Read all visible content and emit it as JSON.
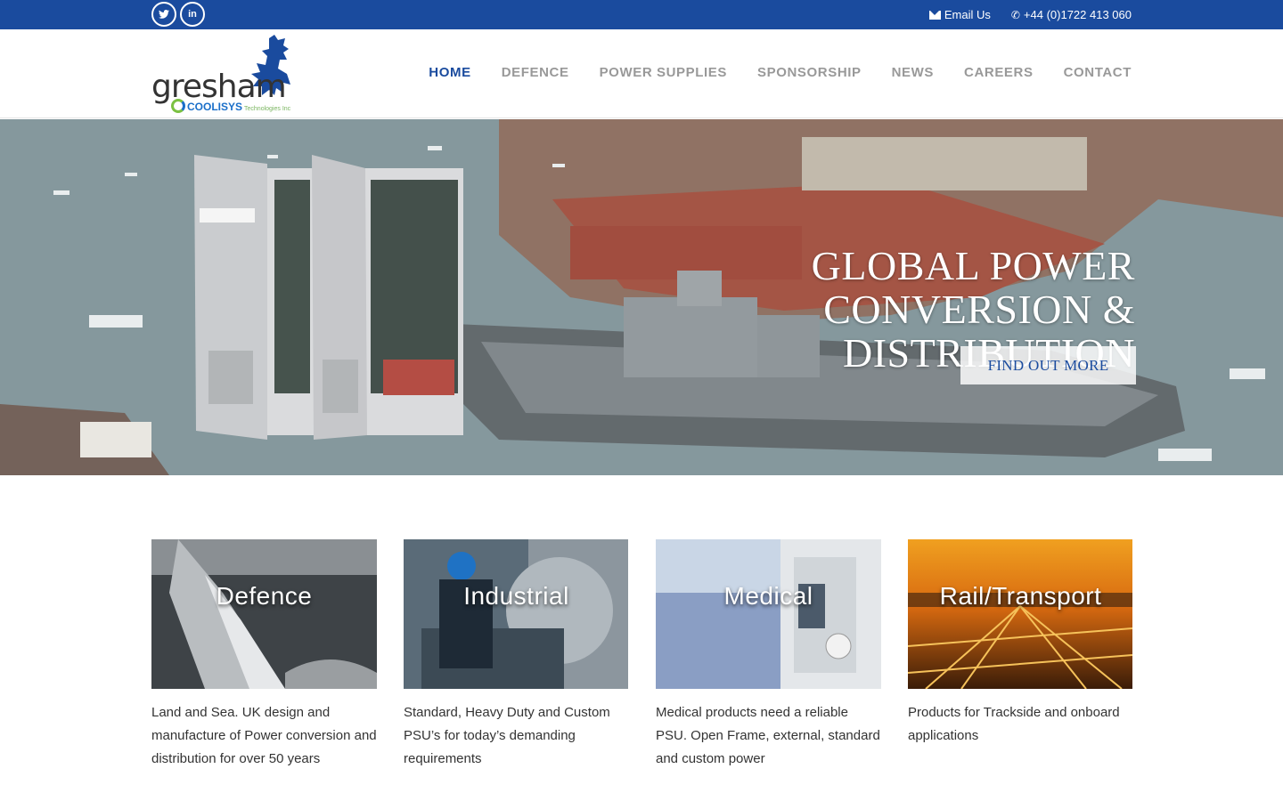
{
  "topbar": {
    "social": [
      {
        "icon": "twitter-icon",
        "glyph": "🐦"
      },
      {
        "icon": "linkedin-icon",
        "glyph": "in"
      }
    ],
    "email_label": "Email Us",
    "phone_label": "+44 (0)1722 413 060"
  },
  "brand": {
    "name": "gresham",
    "sub_brand": "COOLISYS",
    "sub_brand_tag": "Technologies Inc"
  },
  "nav": {
    "items": [
      {
        "label": "HOME",
        "active": true
      },
      {
        "label": "DEFENCE",
        "active": false
      },
      {
        "label": "POWER SUPPLIES",
        "active": false
      },
      {
        "label": "SPONSORSHIP",
        "active": false
      },
      {
        "label": "NEWS",
        "active": false
      },
      {
        "label": "CAREERS",
        "active": false
      },
      {
        "label": "CONTACT",
        "active": false
      }
    ]
  },
  "hero": {
    "title_line1": "GLOBAL POWER",
    "title_line2": "CONVERSION &",
    "title_line3": "DISTRIBUTION",
    "cta_label": "FIND OUT MORE"
  },
  "cards": [
    {
      "title": "Defence",
      "text": "Land and Sea. UK design and manufacture of Power conversion and distribution for over 50 years"
    },
    {
      "title": "Industrial",
      "text": "Standard, Heavy Duty and Custom PSU’s for today’s demanding requirements"
    },
    {
      "title": "Medical",
      "text": "Medical products need a reliable PSU. Open Frame, external, standard and custom power"
    },
    {
      "title": "Rail/Transport",
      "text": "Products for Trackside and onboard applications"
    }
  ],
  "colors": {
    "topbar": "#1a4b9e",
    "nav_active": "#1a4b9e",
    "nav_inactive": "#999999"
  }
}
